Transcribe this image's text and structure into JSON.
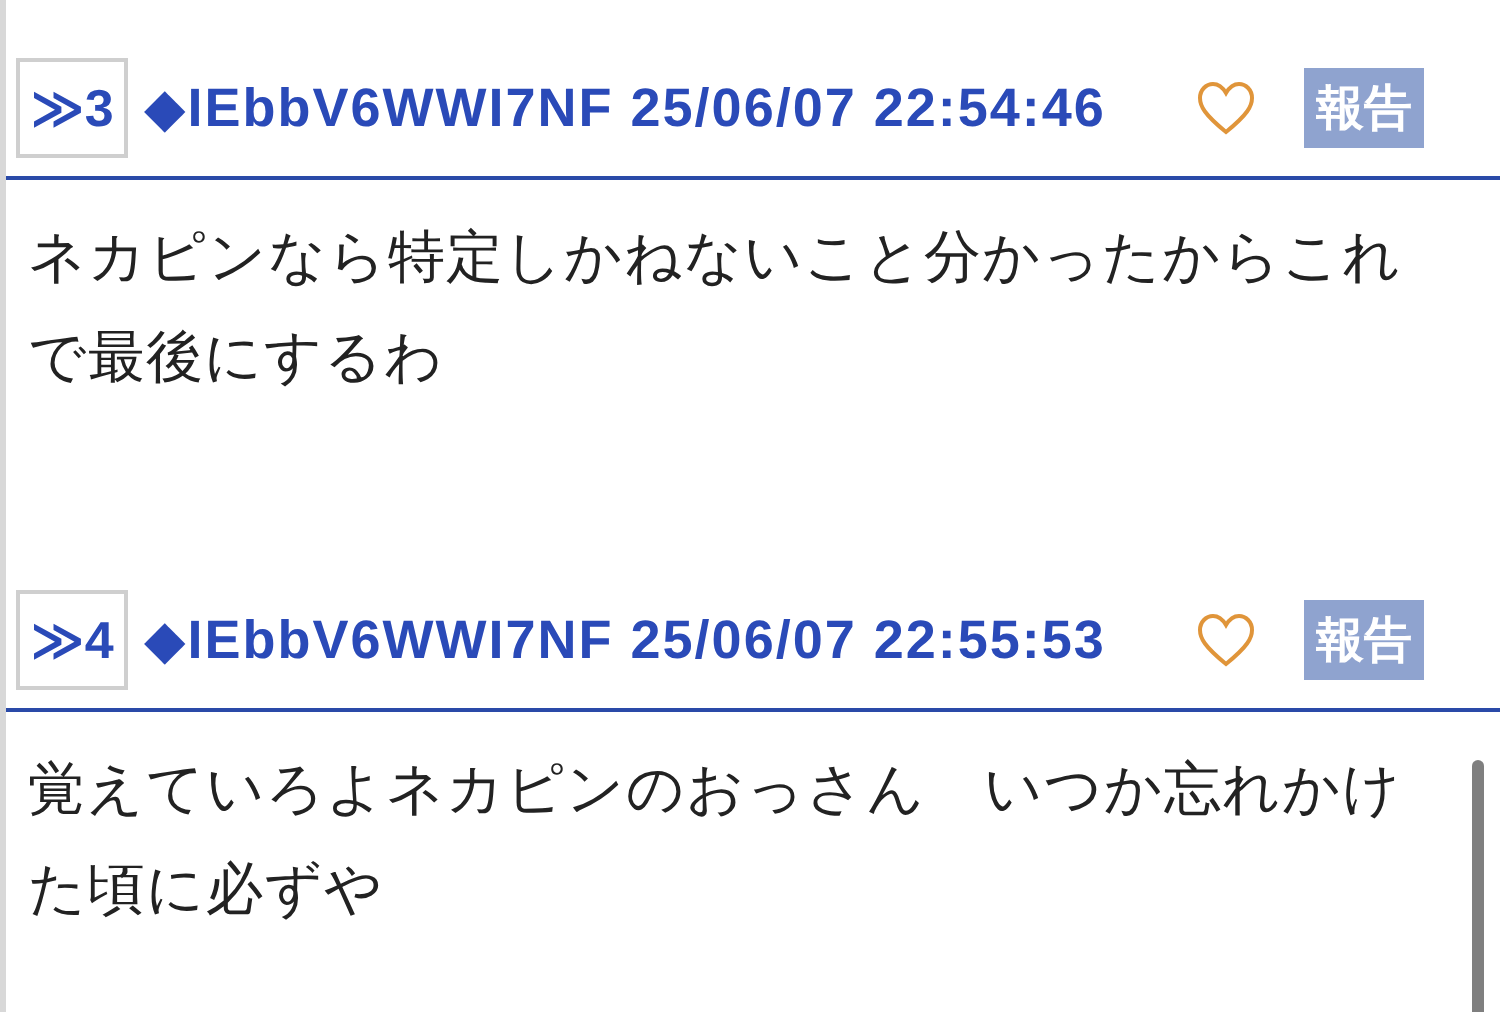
{
  "posts": [
    {
      "number": "≫3",
      "author_line": "◆IEbbV6WWI7NF 25/06/07 22:54:46",
      "report_label": "報告",
      "body": "ネカピンなら特定しかねないこと分かったからこれで最後にするわ"
    },
    {
      "number": "≫4",
      "author_line": "◆IEbbV6WWI7NF 25/06/07 22:55:53",
      "report_label": "報告",
      "body": "覚えていろよネカピンのおっさん　いつか忘れかけた頃に必ずや"
    }
  ]
}
